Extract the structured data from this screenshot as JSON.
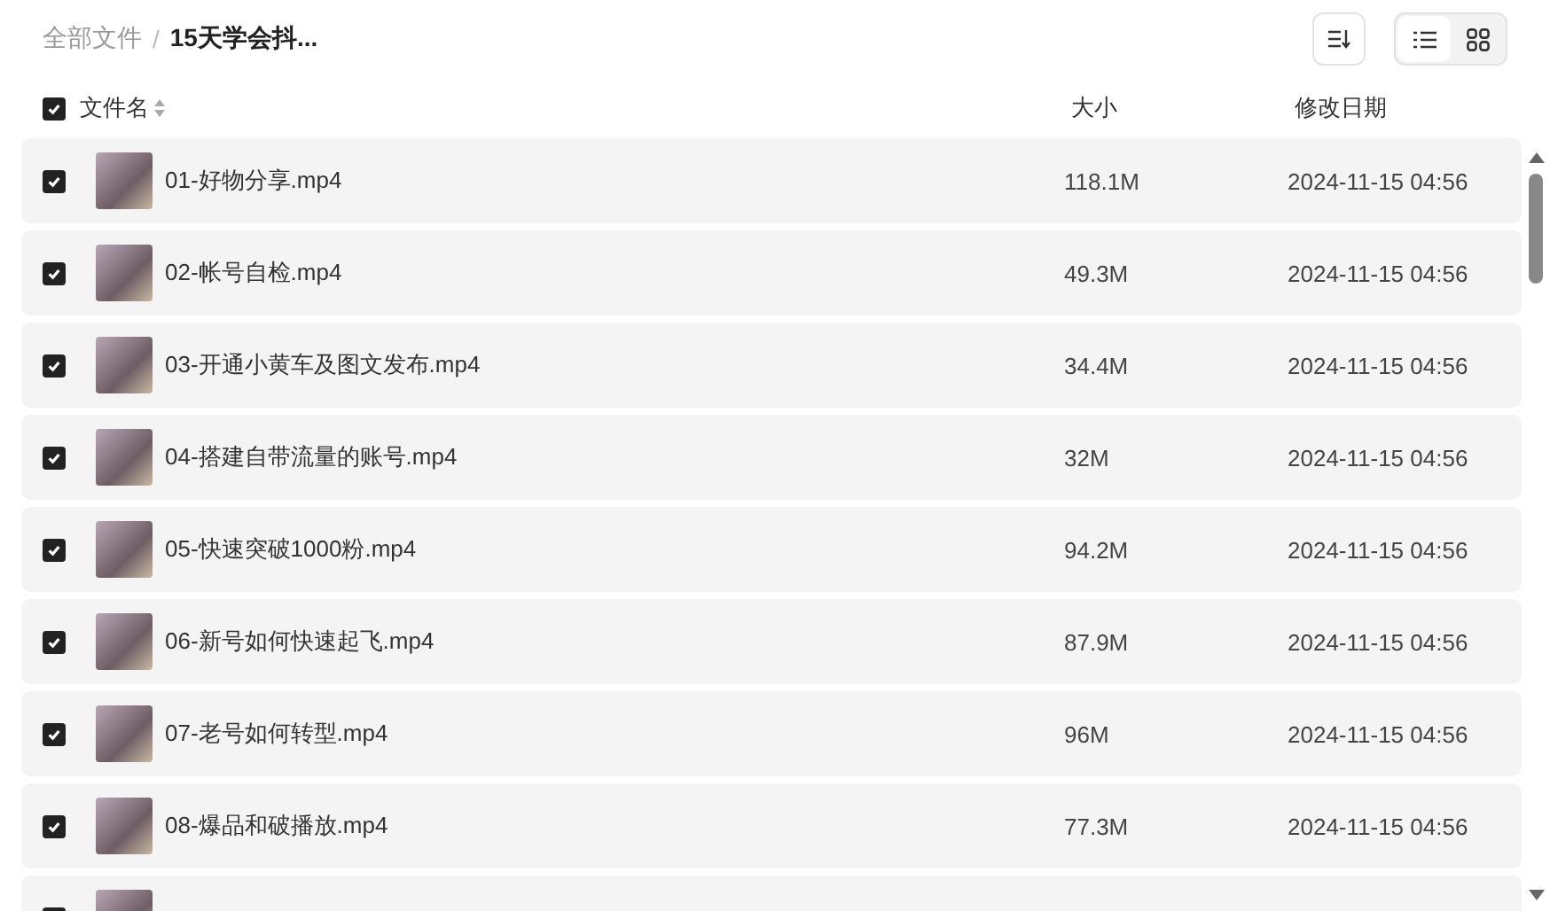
{
  "breadcrumb_separator": "/",
  "breadcrumb": [
    {
      "label": "全部文件",
      "current": false
    },
    {
      "label": "15天学会抖...",
      "current": true
    }
  ],
  "view_toggle": [
    {
      "kind": "list",
      "selected": true
    },
    {
      "kind": "grid",
      "selected": false
    }
  ],
  "table": {
    "select_all": {
      "checked": true
    },
    "columns": [
      {
        "label": "文件名",
        "sortable": true
      },
      {
        "label": "大小",
        "sortable": false
      },
      {
        "label": "修改日期",
        "sortable": false
      }
    ],
    "rows": [
      {
        "checked": true,
        "name": "01-好物分享.mp4",
        "size": "118.1M",
        "date": "2024-11-15 04:56"
      },
      {
        "checked": true,
        "name": "02-帐号自检.mp4",
        "size": "49.3M",
        "date": "2024-11-15 04:56"
      },
      {
        "checked": true,
        "name": "03-开通小黄车及图文发布.mp4",
        "size": "34.4M",
        "date": "2024-11-15 04:56"
      },
      {
        "checked": true,
        "name": "04-搭建自带流量的账号.mp4",
        "size": "32M",
        "date": "2024-11-15 04:56"
      },
      {
        "checked": true,
        "name": "05-快速突破1000粉.mp4",
        "size": "94.2M",
        "date": "2024-11-15 04:56"
      },
      {
        "checked": true,
        "name": "06-新号如何快速起飞.mp4",
        "size": "87.9M",
        "date": "2024-11-15 04:56"
      },
      {
        "checked": true,
        "name": "07-老号如何转型.mp4",
        "size": "96M",
        "date": "2024-11-15 04:56"
      },
      {
        "checked": true,
        "name": "08-爆品和破播放.mp4",
        "size": "77.3M",
        "date": "2024-11-15 04:56"
      },
      {
        "checked": true
      }
    ]
  }
}
